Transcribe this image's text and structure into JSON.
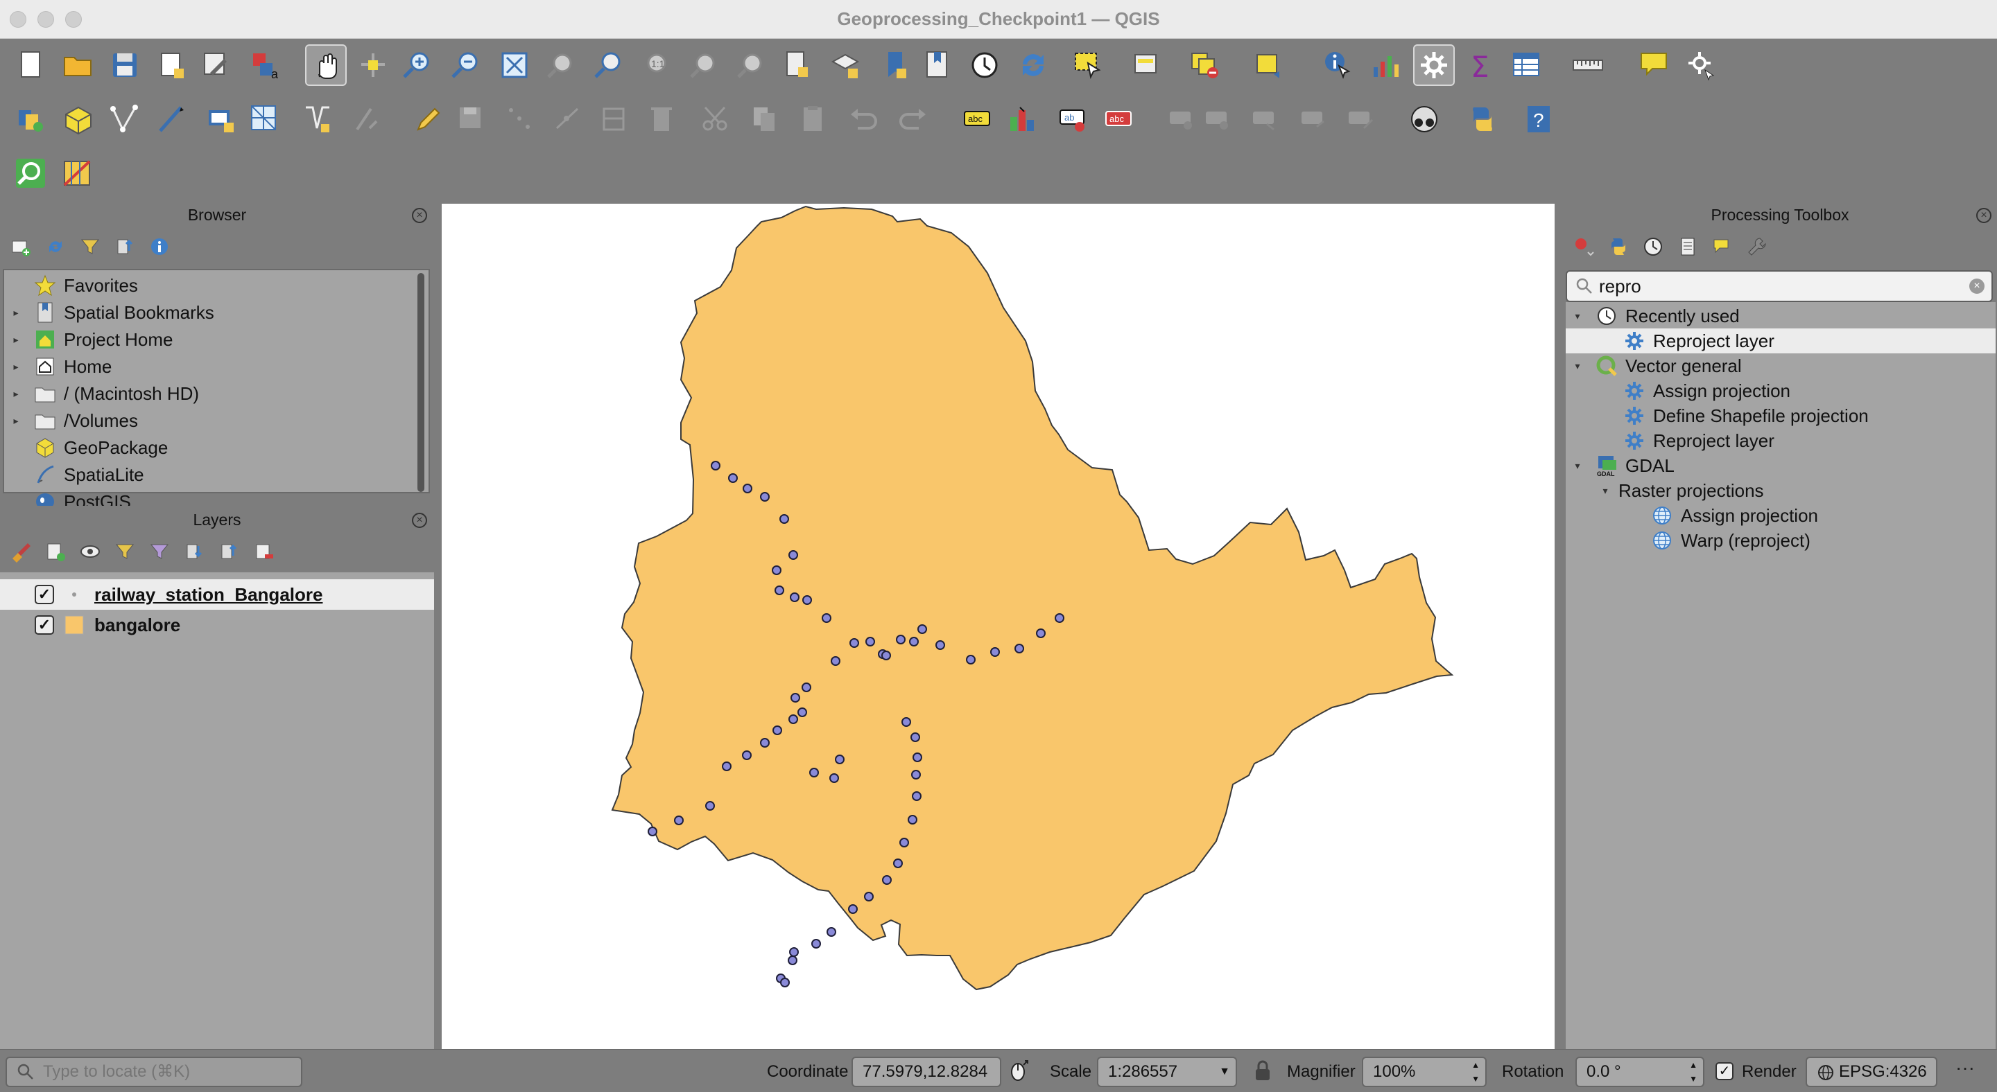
{
  "window": {
    "title": "Geoprocessing_Checkpoint1 — QGIS"
  },
  "toolbars": {
    "row1": [
      "new-project-icon",
      "open-project-icon",
      "save-project-icon",
      "new-print-layout-icon",
      "style-manager-icon",
      "text-annotation-icon",
      "pan-map-icon",
      "pan-to-selection-icon",
      "zoom-in-icon",
      "zoom-out-icon",
      "zoom-full-icon",
      "zoom-to-selection-icon",
      "zoom-to-layer-icon",
      "zoom-native-icon",
      "zoom-last-icon",
      "zoom-next-icon",
      "new-map-view-icon",
      "new-3d-map-icon",
      "new-bookmark-icon",
      "show-bookmarks-icon",
      "temporal-controller-icon",
      "refresh-icon",
      "select-features-icon",
      "attribute-table-select-icon",
      "deselect-icon",
      "select-by-location-icon",
      "identify-icon",
      "statistics-icon",
      "processing-toolbox-icon",
      "sum-icon",
      "attribute-table-icon",
      "measure-icon",
      "map-tips-icon",
      "options-icon"
    ],
    "row2": [
      "data-source-manager-icon",
      "new-geopackage-icon",
      "digitize-icon",
      "trace-icon",
      "add-layer-icon",
      "mesh-icon",
      "vertex-tool-icon",
      "snapping-icon",
      "pencil-icon",
      "save-edits-icon",
      "move-icon",
      "node-icon",
      "split-icon",
      "delete-icon",
      "cut-icon",
      "copy-icon",
      "paste-icon",
      "undo-icon",
      "redo-icon",
      "label-icon",
      "diagram-icon",
      "label-pin-icon",
      "label-highlight-icon",
      "label-move-icon",
      "label-rotate-icon",
      "label-change-icon",
      "label-show-icon",
      "label-edit-icon",
      "plugin-icon",
      "python-icon",
      "help-icon"
    ],
    "row3": [
      "locator-icon",
      "georeferencer-icon"
    ]
  },
  "browser": {
    "title": "Browser",
    "items": [
      {
        "label": "Favorites",
        "icon": "star-icon",
        "expandable": false
      },
      {
        "label": "Spatial Bookmarks",
        "icon": "bookmark-icon",
        "expandable": true
      },
      {
        "label": "Project Home",
        "icon": "project-home-icon",
        "expandable": true
      },
      {
        "label": "Home",
        "icon": "home-icon",
        "expandable": true
      },
      {
        "label": "/ (Macintosh HD)",
        "icon": "folder-icon",
        "expandable": true
      },
      {
        "label": "/Volumes",
        "icon": "folder-icon",
        "expandable": true
      },
      {
        "label": "GeoPackage",
        "icon": "geopackage-icon",
        "expandable": false
      },
      {
        "label": "SpatiaLite",
        "icon": "spatialite-icon",
        "expandable": false
      },
      {
        "label": "PostGIS",
        "icon": "postgis-icon",
        "expandable": false
      }
    ]
  },
  "layers": {
    "title": "Layers",
    "items": [
      {
        "name": "railway_station_Bangalore",
        "checked": true,
        "type": "point",
        "selected": true
      },
      {
        "name": "bangalore",
        "checked": true,
        "type": "polygon",
        "fill": "#f9c66b",
        "selected": false
      }
    ]
  },
  "processing": {
    "title": "Processing Toolbox",
    "search_value": "repro",
    "tree": [
      {
        "label": "Recently used",
        "level": 0,
        "icon": "clock-icon",
        "expanded": true
      },
      {
        "label": "Reproject layer",
        "level": 1,
        "icon": "gear-icon",
        "selected": true
      },
      {
        "label": "Vector general",
        "level": 0,
        "icon": "qgis-logo-icon",
        "expanded": true
      },
      {
        "label": "Assign projection",
        "level": 1,
        "icon": "gear-icon"
      },
      {
        "label": "Define Shapefile projection",
        "level": 1,
        "icon": "gear-icon"
      },
      {
        "label": "Reproject layer",
        "level": 1,
        "icon": "gear-icon"
      },
      {
        "label": "GDAL",
        "level": 0,
        "icon": "gdal-icon",
        "expanded": true
      },
      {
        "label": "Raster projections",
        "level": 1,
        "icon": "",
        "expanded": true
      },
      {
        "label": "Assign projection",
        "level": 2,
        "icon": "globe-icon"
      },
      {
        "label": "Warp (reproject)",
        "level": 2,
        "icon": "globe-icon"
      }
    ]
  },
  "map": {
    "polygon_fill": "#f9c66b",
    "polygon_stroke": "#3a3a3a",
    "station_fill": "#8a8ad8",
    "station_stroke": "#1f1f3a"
  },
  "statusbar": {
    "locator_placeholder": "Type to locate (⌘K)",
    "coordinate_label": "Coordinate",
    "coordinate_value": "77.5979,12.8284",
    "scale_label": "Scale",
    "scale_value": "1:286557",
    "magnifier_label": "Magnifier",
    "magnifier_value": "100%",
    "rotation_label": "Rotation",
    "rotation_value": "0.0 °",
    "render_label": "Render",
    "render_checked": true,
    "crs_label": "EPSG:4326"
  }
}
